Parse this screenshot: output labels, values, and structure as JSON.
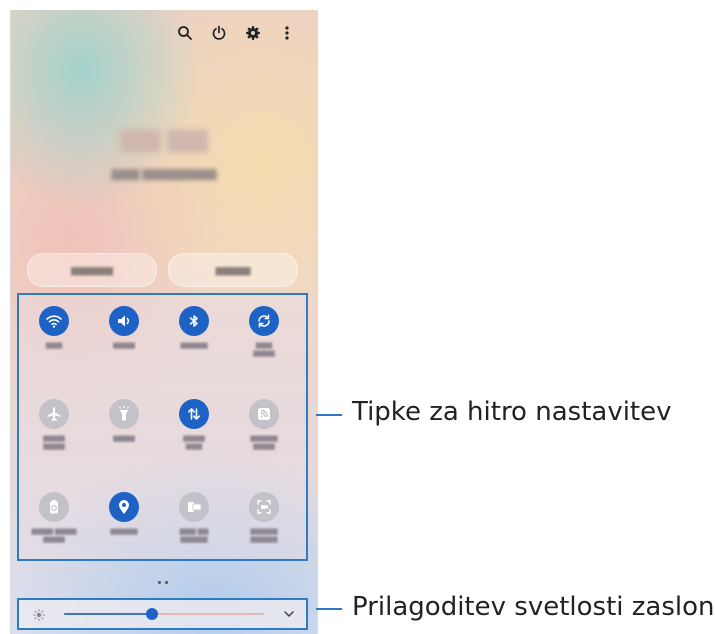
{
  "top_icons": [
    "search-icon",
    "power-icon",
    "gear-icon",
    "more-vertical-icon"
  ],
  "annotations": {
    "quick_settings": "Tipke za hitro nastavitev",
    "brightness": "Prilagoditev svetlosti zaslona."
  },
  "brightness": {
    "level_fraction": 0.44
  },
  "quick_tiles": [
    {
      "icon": "wifi-icon",
      "active": true
    },
    {
      "icon": "sound-icon",
      "active": true
    },
    {
      "icon": "bluetooth-icon",
      "active": true
    },
    {
      "icon": "auto-rotate-icon",
      "active": true
    },
    {
      "icon": "airplane-icon",
      "active": false
    },
    {
      "icon": "flashlight-icon",
      "active": false
    },
    {
      "icon": "mobile-data-icon",
      "active": true
    },
    {
      "icon": "hotspot-icon",
      "active": false
    },
    {
      "icon": "power-saving-icon",
      "active": false
    },
    {
      "icon": "location-icon",
      "active": true
    },
    {
      "icon": "link-to-windows-icon",
      "active": false
    },
    {
      "icon": "screen-recorder-icon",
      "active": false
    }
  ],
  "colors": {
    "accent": "#2f7ac5",
    "tile_on": "#1f62c6",
    "tile_off": "#c2c2c8"
  }
}
